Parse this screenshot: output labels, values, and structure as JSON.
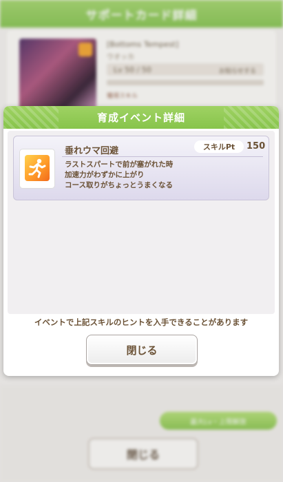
{
  "background": {
    "header_title": "サポートカード詳細",
    "card_title": "[Bottoms Tempest]",
    "card_name": "ウオッカ",
    "level_text": "Lv 50 / 50",
    "level_right": "お知らせする",
    "label": "獲得スキル",
    "green_button": "最大Lv・上限解放",
    "close_button": "閉じる"
  },
  "dialog": {
    "title": "育成イベント詳細",
    "skill": {
      "icon": "speed-skill-icon",
      "name": "垂れウマ回避",
      "pt_label": "スキルPt",
      "pt_value": "150",
      "description": [
        "ラストスパートで前が塞がれた時",
        "加速力がわずかに上がり",
        "コース取りがちょっとうまくなる"
      ]
    },
    "notice": "イベントで上記スキルのヒントを入手できることがあります",
    "close_button": "閉じる"
  },
  "colors": {
    "header_green": "#8cc64f",
    "text_brown": "#6b5236",
    "skill_icon_orange": "#ff9c2a"
  }
}
